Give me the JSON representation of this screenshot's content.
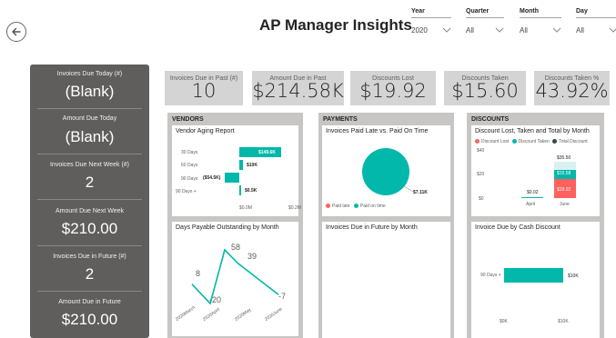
{
  "header": {
    "title": "AP Manager Insights",
    "back_icon": "back-arrow-icon"
  },
  "slicers": [
    {
      "label": "Year",
      "value": "2020"
    },
    {
      "label": "Quarter",
      "value": "All"
    },
    {
      "label": "Month",
      "value": "All"
    },
    {
      "label": "Day",
      "value": "All"
    }
  ],
  "left_panel": [
    {
      "label": "Invoices Due Today (#)",
      "value": "(Blank)"
    },
    {
      "label": "Amount Due Today",
      "value": "(Blank)"
    },
    {
      "label": "Invoices Due Next Week (#)",
      "value": "2"
    },
    {
      "label": "Amount Due Next Week",
      "value": "$210.00"
    },
    {
      "label": "Invoices Due in Future (#)",
      "value": "2"
    },
    {
      "label": "Amount Due in Future",
      "value": "$210.00"
    }
  ],
  "kpis": [
    {
      "label": "Invoices Due in Past (#)",
      "value": "10"
    },
    {
      "label": "Amount Due in Past",
      "value": "$214.58K"
    },
    {
      "label": "Discounts Lost",
      "value": "$19.92"
    },
    {
      "label": "Discounts Taken",
      "value": "$15.60"
    },
    {
      "label": "Discounts Taken %",
      "value": "43.92%"
    }
  ],
  "sections": {
    "vendors": {
      "title": "VENDORS"
    },
    "payments": {
      "title": "PAYMENTS"
    },
    "discounts": {
      "title": "DISCOUNTS"
    }
  },
  "charts": {
    "aging": {
      "title": "Vendor Aging Report",
      "x_ticks": [
        "$0.0M",
        "$0.2M"
      ],
      "color": "#01b8aa"
    },
    "dpo": {
      "title": "Days Payable Outstanding by Month",
      "color": "#01b8aa"
    },
    "paid_late": {
      "title": "Invoices Paid Late vs. Paid On Time",
      "slice_label": "$7.11K",
      "legend": [
        {
          "name": "Paid late",
          "color": "#fd625e"
        },
        {
          "name": "Paid on time",
          "color": "#01b8aa"
        }
      ]
    },
    "future": {
      "title": "Invoices Due in Future by Month"
    },
    "discount_month": {
      "title": "Discount Lost, Taken and Total by Month",
      "y_ticks": [
        "$40",
        "$20",
        "$0"
      ],
      "legend": [
        {
          "name": "Discount Lost",
          "color": "#fd625e"
        },
        {
          "name": "Discount Taken",
          "color": "#01b8aa"
        },
        {
          "name": "Total Discount",
          "color": "#374649"
        }
      ]
    },
    "cash_discount": {
      "title": "Invoice Due by Cash Discount",
      "x_ticks": [
        "$0K",
        "$10K"
      ],
      "color": "#01b8aa"
    }
  },
  "chart_data": [
    {
      "type": "bar",
      "orientation": "horizontal",
      "title": "Vendor Aging Report",
      "categories": [
        "30 Days",
        "60 Days",
        "90 Days",
        "90 Days +"
      ],
      "values": [
        0.1496,
        0.01,
        -0.0545,
        0.0005
      ],
      "data_labels": [
        "$149.6K",
        "$10K",
        "($54.5K)",
        "$0.5K"
      ],
      "xlim": [
        -0.06,
        0.2
      ],
      "xlabel": "",
      "ylabel": ""
    },
    {
      "type": "line",
      "title": "Days Payable Outstanding by Month",
      "categories": [
        "2020March",
        "2020April",
        "2020May",
        "2020June"
      ],
      "series": [
        {
          "values": [
            8,
            -20,
            58,
            39,
            -7
          ]
        }
      ],
      "x_positions": [
        "2020March",
        "2020April",
        "2020April-2020May",
        "2020May",
        "2020June"
      ],
      "data_labels": [
        "8",
        "-20",
        "58",
        "39",
        "-7"
      ]
    },
    {
      "type": "pie",
      "title": "Invoices Paid Late vs. Paid On Time",
      "categories": [
        "Paid late",
        "Paid on time"
      ],
      "values": [
        0,
        7110
      ],
      "data_labels": [
        "$7.11K"
      ]
    },
    {
      "type": "bar",
      "stacked": true,
      "title": "Discount Lost, Taken and Total by Month",
      "categories": [
        "April",
        "June"
      ],
      "series": [
        {
          "name": "Discount Lost",
          "values": [
            0,
            19.92
          ]
        },
        {
          "name": "Discount Taken",
          "values": [
            0.02,
            15.58
          ]
        },
        {
          "name": "Total Discount",
          "values": [
            0.02,
            35.5
          ]
        }
      ],
      "data_labels": {
        "April": [
          "$0.02"
        ],
        "June": [
          "$35.50",
          "$15.58",
          "$19.92"
        ]
      },
      "ylim": [
        0,
        40
      ],
      "y_ticks": [
        "$0",
        "$20",
        "$40"
      ]
    },
    {
      "type": "bar",
      "orientation": "horizontal",
      "title": "Invoice Due by Cash Discount",
      "categories": [
        "90 Days +"
      ],
      "values": [
        10
      ],
      "data_labels": [
        "$10K"
      ],
      "xlim": [
        0,
        12
      ],
      "x_ticks": [
        "$0K",
        "$10K"
      ]
    }
  ]
}
